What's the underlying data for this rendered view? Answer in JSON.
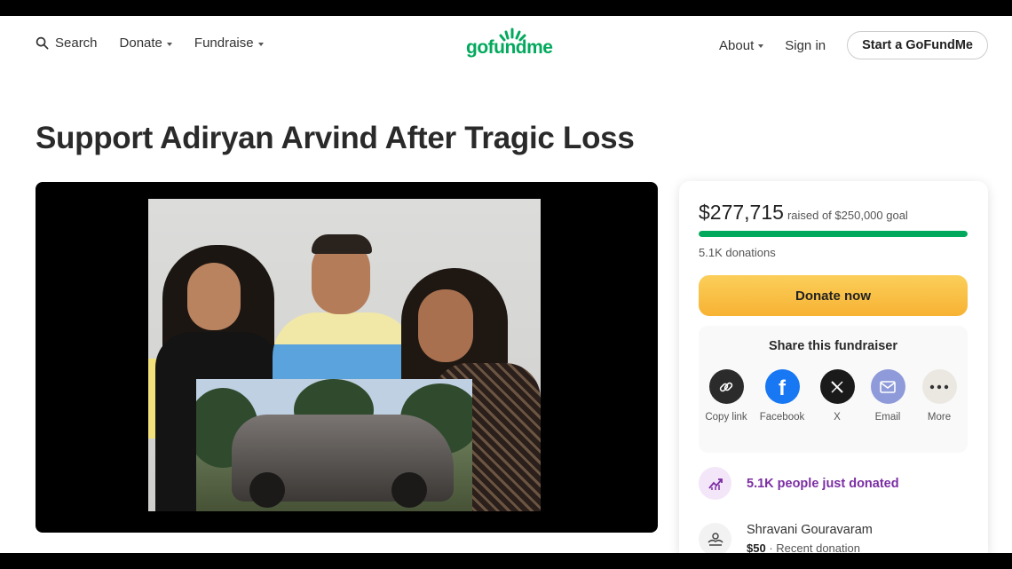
{
  "nav": {
    "search_label": "Search",
    "donate_label": "Donate",
    "fundraise_label": "Fundraise",
    "logo_text": "gofundme",
    "about_label": "About",
    "signin_label": "Sign in",
    "start_label": "Start a GoFundMe"
  },
  "campaign": {
    "title": "Support Adiryan Arvind After Tragic Loss"
  },
  "panel": {
    "raised_amount": "$277,715",
    "goal_text": "raised of $250,000 goal",
    "progress_fraction": 1.0,
    "donations_text": "5.1K donations",
    "donate_button": "Donate now",
    "share_title": "Share this fundraiser",
    "share_options": [
      {
        "label": "Copy link",
        "icon": "link-icon"
      },
      {
        "label": "Facebook",
        "icon": "facebook-icon"
      },
      {
        "label": "X",
        "icon": "x-icon"
      },
      {
        "label": "Email",
        "icon": "email-icon"
      },
      {
        "label": "More",
        "icon": "more-icon"
      }
    ],
    "social_proof": "5.1K people just donated",
    "recent_donor": {
      "name": "Shravani Gouravaram",
      "amount": "$50",
      "note": "Recent donation"
    }
  },
  "colors": {
    "brand_green": "#02a95c",
    "donate_yellow": "#f7b233",
    "social_purple": "#7b2ea3"
  }
}
